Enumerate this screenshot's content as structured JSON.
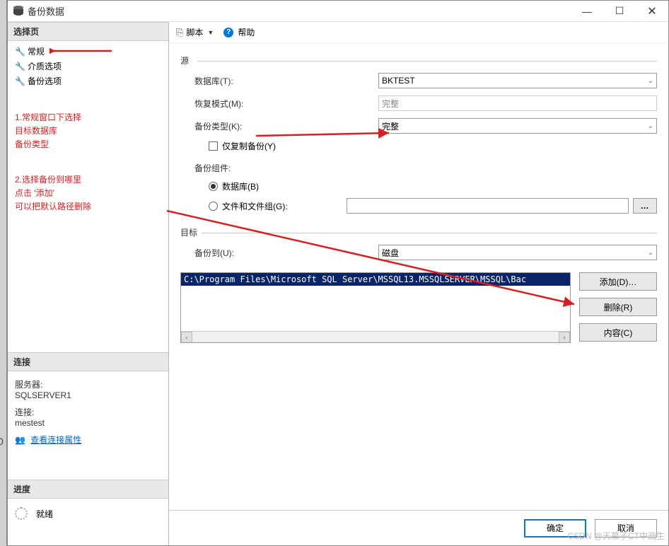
{
  "window": {
    "title": "备份数据"
  },
  "sidebar": {
    "section_pages": "选择页",
    "pages": [
      {
        "label": "常规"
      },
      {
        "label": "介质选项"
      },
      {
        "label": "备份选项"
      }
    ],
    "annotation1_l1": "1.常规窗口下选择",
    "annotation1_l2": "目标数据库",
    "annotation1_l3": "备份类型",
    "annotation2_l1": "2.选择备份到哪里",
    "annotation2_l2": "点击 '添加'",
    "annotation2_l3": "可以把默认路径删除",
    "section_conn": "连接",
    "server_label": "服务器:",
    "server_value": "SQLSERVER1",
    "conn_label": "连接:",
    "conn_value": "mestest",
    "view_props": "查看连接属性",
    "section_progress": "进度",
    "progress_status": "就绪"
  },
  "toolbar": {
    "script": "脚本",
    "help": "帮助"
  },
  "form": {
    "source_legend": "源",
    "database_label": "数据库(T):",
    "database_value": "BKTEST",
    "recovery_label": "恢复模式(M):",
    "recovery_value": "完整",
    "backup_type_label": "备份类型(K):",
    "backup_type_value": "完整",
    "copy_only_label": "仅复制备份(Y)",
    "component_label": "备份组件:",
    "radio_db": "数据库(B)",
    "radio_files": "文件和文件组(G):",
    "dest_legend": "目标",
    "backup_to_label": "备份到(U):",
    "backup_to_value": "磁盘",
    "path_item": "C:\\Program Files\\Microsoft SQL Server\\MSSQL13.MSSQLSERVER\\MSSQL\\Bac",
    "add_btn": "添加(D)…",
    "remove_btn": "删除(R)",
    "contents_btn": "内容(C)"
  },
  "footer": {
    "ok": "确定",
    "cancel": "取消"
  },
  "watermark": "CSDN @天幕子CT中画生"
}
